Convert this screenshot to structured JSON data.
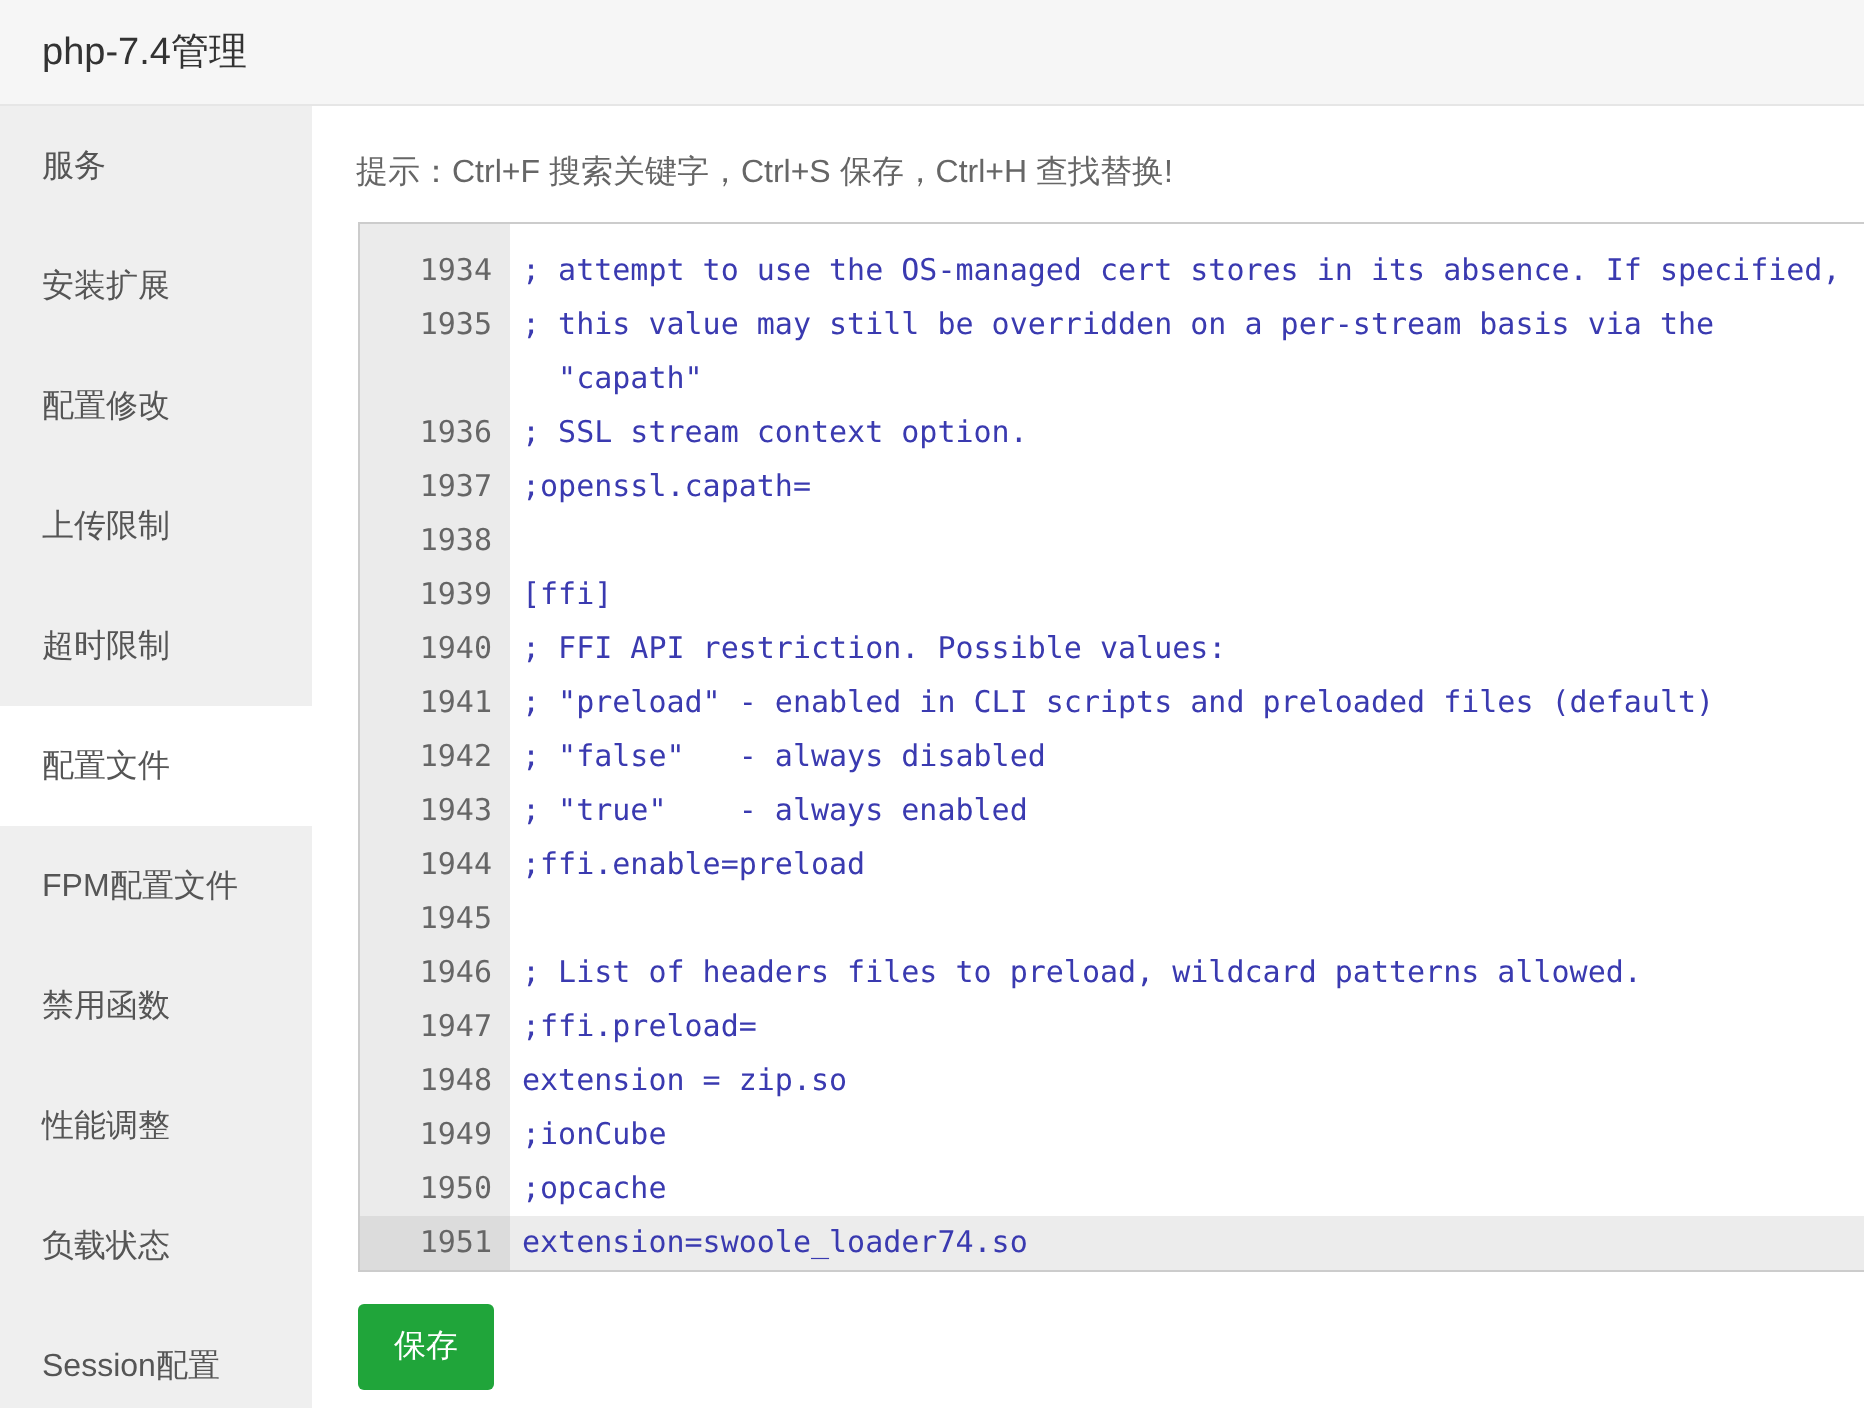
{
  "window": {
    "title": "php-7.4管理"
  },
  "sidebar": {
    "items": [
      {
        "label": "服务",
        "selected": false
      },
      {
        "label": "安装扩展",
        "selected": false
      },
      {
        "label": "配置修改",
        "selected": false
      },
      {
        "label": "上传限制",
        "selected": false
      },
      {
        "label": "超时限制",
        "selected": false
      },
      {
        "label": "配置文件",
        "selected": true
      },
      {
        "label": "FPM配置文件",
        "selected": false
      },
      {
        "label": "禁用函数",
        "selected": false
      },
      {
        "label": "性能调整",
        "selected": false
      },
      {
        "label": "负载状态",
        "selected": false
      },
      {
        "label": "Session配置",
        "selected": false
      }
    ]
  },
  "hint": "提示：Ctrl+F 搜索关键字，Ctrl+S 保存，Ctrl+H 查找替换!",
  "editor": {
    "lines": [
      {
        "number": "1934",
        "text": "; attempt to use the OS-managed cert stores in its absence. If specified,",
        "active": false
      },
      {
        "number": "1935",
        "text": "; this value may still be overridden on a per-stream basis via the \"capath\"",
        "active": false
      },
      {
        "number": "1936",
        "text": "; SSL stream context option.",
        "active": false
      },
      {
        "number": "1937",
        "text": ";openssl.capath=",
        "active": false
      },
      {
        "number": "1938",
        "active": false
      },
      {
        "number": "1939",
        "text": "[ffi]",
        "active": false
      },
      {
        "number": "1940",
        "text": "; FFI API restriction. Possible values:",
        "active": false
      },
      {
        "number": "1941",
        "text": "; \"preload\" - enabled in CLI scripts and preloaded files (default)",
        "active": false
      },
      {
        "number": "1942",
        "text": "; \"false\"   - always disabled",
        "active": false
      },
      {
        "number": "1943",
        "text": "; \"true\"    - always enabled",
        "active": false
      },
      {
        "number": "1944",
        "text": ";ffi.enable=preload",
        "active": false
      },
      {
        "number": "1945",
        "active": false
      },
      {
        "number": "1946",
        "text": "; List of headers files to preload, wildcard patterns allowed.",
        "active": false
      },
      {
        "number": "1947",
        "text": ";ffi.preload=",
        "active": false
      },
      {
        "number": "1948",
        "text": "extension = zip.so",
        "active": false
      },
      {
        "number": "1949",
        "text": ";ionCube",
        "active": false
      },
      {
        "number": "1950",
        "text": ";opcache",
        "active": false
      },
      {
        "number": "1951",
        "text": "extension=swoole_loader74.so",
        "active": true
      }
    ]
  },
  "save_button": {
    "label": "保存"
  }
}
